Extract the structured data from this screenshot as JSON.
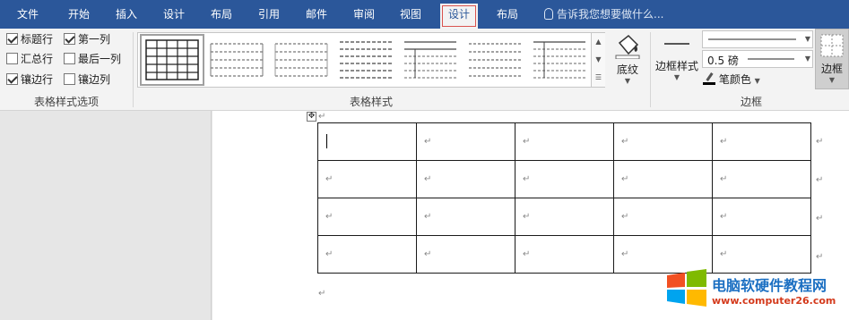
{
  "tabs": [
    {
      "label": "文件"
    },
    {
      "label": "开始"
    },
    {
      "label": "插入"
    },
    {
      "label": "设计"
    },
    {
      "label": "布局"
    },
    {
      "label": "引用"
    },
    {
      "label": "邮件"
    },
    {
      "label": "审阅"
    },
    {
      "label": "视图"
    },
    {
      "label": "设计",
      "active": true
    },
    {
      "label": "布局"
    }
  ],
  "tell_me": "告诉我您想要做什么...",
  "style_options": {
    "group_label": "表格样式选项",
    "items": [
      {
        "label": "标题行",
        "checked": true
      },
      {
        "label": "第一列",
        "checked": true
      },
      {
        "label": "汇总行",
        "checked": false
      },
      {
        "label": "最后一列",
        "checked": false
      },
      {
        "label": "镶边行",
        "checked": true
      },
      {
        "label": "镶边列",
        "checked": false
      }
    ]
  },
  "table_styles": {
    "group_label": "表格样式",
    "shading_label": "底纹"
  },
  "borders": {
    "group_label": "边框",
    "border_styles_label": "边框样式",
    "weight_value": "0.5 磅",
    "pen_color_label": "笔颜色",
    "borders_label": "边框"
  },
  "colors": {
    "tab_bar": "#2b579a",
    "pen_color": "#000000"
  },
  "watermark": {
    "title": "电脑软硬件教程网",
    "url": "www.computer26.com"
  },
  "document": {
    "rows": 4,
    "cols": 5
  }
}
